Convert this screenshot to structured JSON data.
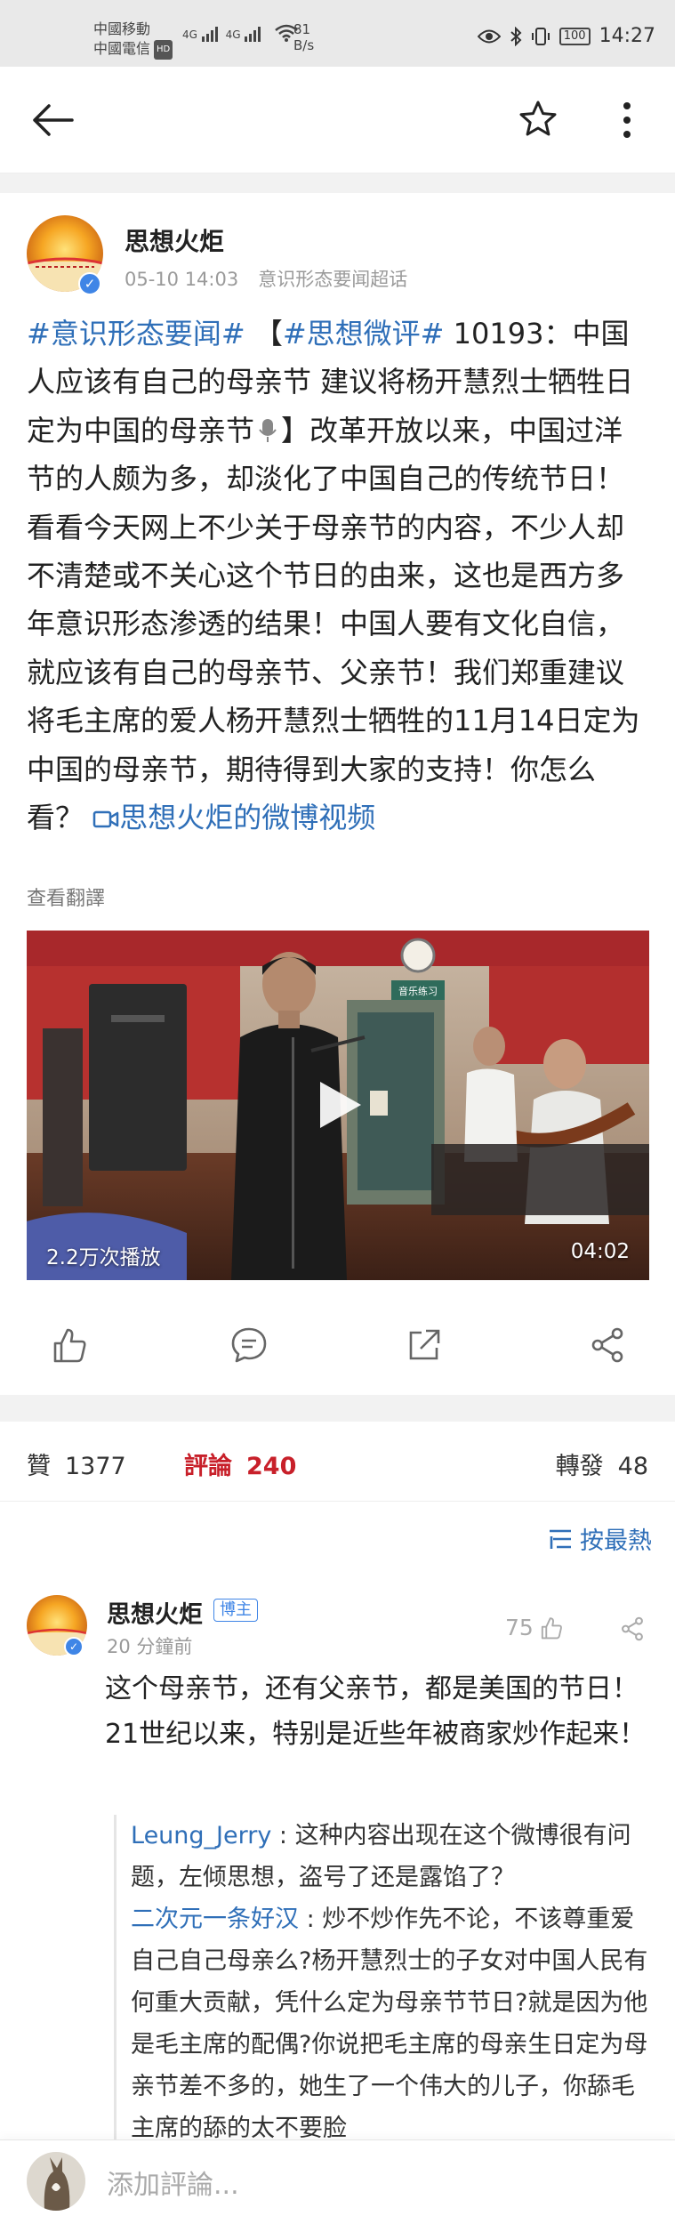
{
  "statusbar": {
    "carrier1": "中國移動",
    "carrier2": "中國電信",
    "hd": "HD",
    "net1": "4G",
    "net2": "4G",
    "speed_value": "81",
    "speed_unit": "B/s",
    "battery": "100",
    "time": "14:27"
  },
  "post": {
    "author": "思想火炬",
    "date": "05-10 14:03",
    "source": "意识形态要闻超话",
    "tag1": "#意识形态要闻#",
    "bracket_open": "【",
    "tag2": "#思想微评#",
    "body1": "10193：中国人应该有自己的母亲节 建议将杨开慧烈士牺牲日定为中国的母亲节",
    "body2": "】改革开放以来，中国过洋节的人颇为多，却淡化了中国自己的传统节日！看看今天网上不少关于母亲节的内容，不少人却不清楚或不关心这个节日的由来，这也是西方多年意识形态渗透的结果！中国人要有文化自信，就应该有自己的母亲节、父亲节！我们郑重建议将毛主席的爱人杨开慧烈士牺牲的11月14日定为中国的母亲节，期待得到大家的支持！你怎么看？",
    "video_link": "思想火炬的微博视频",
    "translate": "查看翻譯"
  },
  "video": {
    "plays": "2.2万次播放",
    "duration": "04:02",
    "sign_text": "音乐练习"
  },
  "actions": [
    "like-icon",
    "comment-icon",
    "repost-icon",
    "share-icon"
  ],
  "counts": {
    "like_label": "贊",
    "like_count": "1377",
    "comment_label": "評論",
    "comment_count": "240",
    "repost_label": "轉發",
    "repost_count": "48"
  },
  "sort_label": "按最熱",
  "comment": {
    "name": "思想火炬",
    "badge": "博主",
    "time": "20 分鐘前",
    "likes": "75",
    "text": "这个母亲节，还有父亲节，都是美国的节日！21世纪以来，特别是近些年被商家炒作起来！",
    "replies": [
      {
        "user": "Leung_Jerry",
        "text": "这种内容出现在这个微博很有问题，左倾思想，盗号了还是露馅了？"
      },
      {
        "user": "二次元一条好汉",
        "text": "炒不炒作先不论，不该尊重爱自己自己母亲么?杨开慧烈士的子女对中国人民有何重大贡献，凭什么定为母亲节节日?就是因为他是毛主席的配偶?你说把毛主席的母亲生日定为母亲节差不多的，她生了一个伟大的儿子，你舔毛主席的舔的太不要脸"
      }
    ]
  },
  "bottom": {
    "input_placeholder": "添加評論..."
  },
  "colors": {
    "link": "#2f6fb8",
    "comment_red": "#c8202a",
    "verify_blue": "#3f85e6",
    "gap_gray": "#f2f2f2"
  }
}
